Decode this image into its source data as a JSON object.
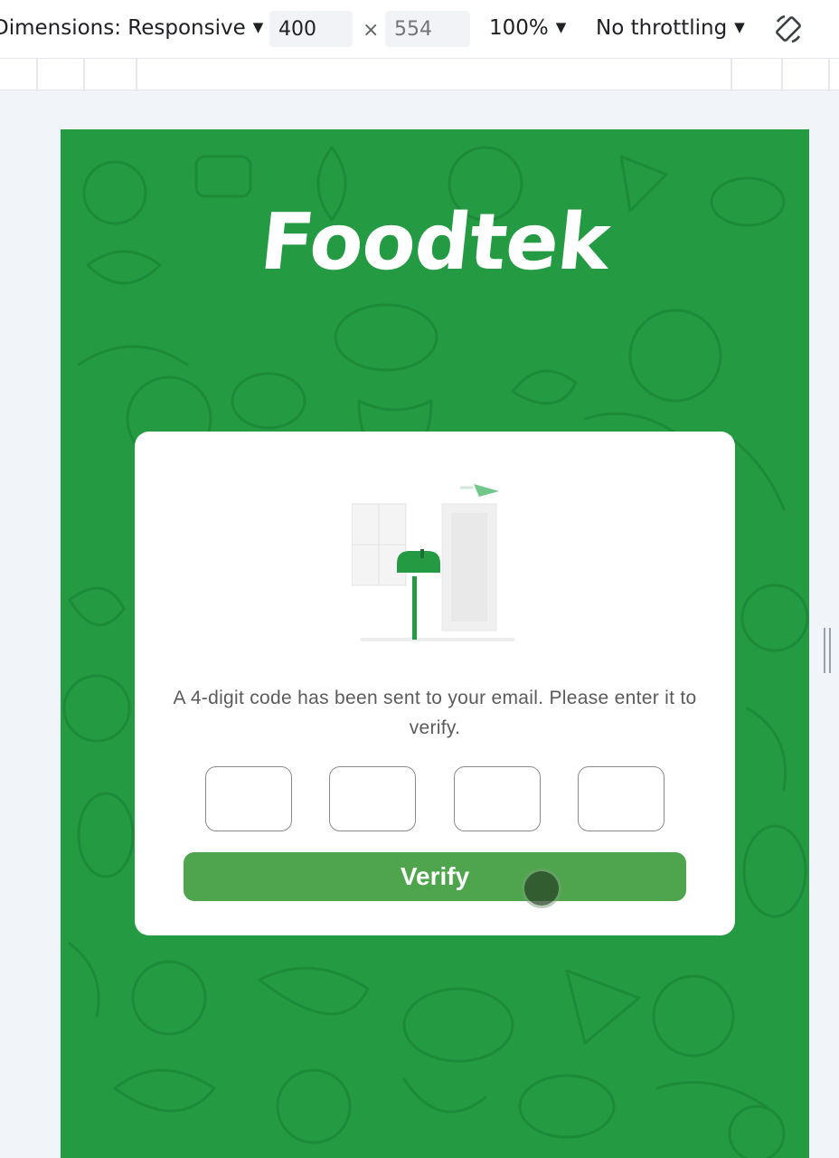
{
  "devtools": {
    "dimensions_label": "Dimensions: Responsive",
    "width_value": "400",
    "height_placeholder": "554",
    "times_symbol": "×",
    "zoom_label": "100%",
    "throttling_label": "No throttling",
    "caret": "▼",
    "rotate_icon": "rotate-icon"
  },
  "app": {
    "brand": "Foodtek",
    "message": "A 4-digit code has been sent to your email. Please enter it to verify.",
    "code_fields": [
      "",
      "",
      "",
      ""
    ],
    "verify_label": "Verify",
    "colors": {
      "background": "#249a43",
      "button": "#4ea54e",
      "card": "#ffffff"
    }
  }
}
